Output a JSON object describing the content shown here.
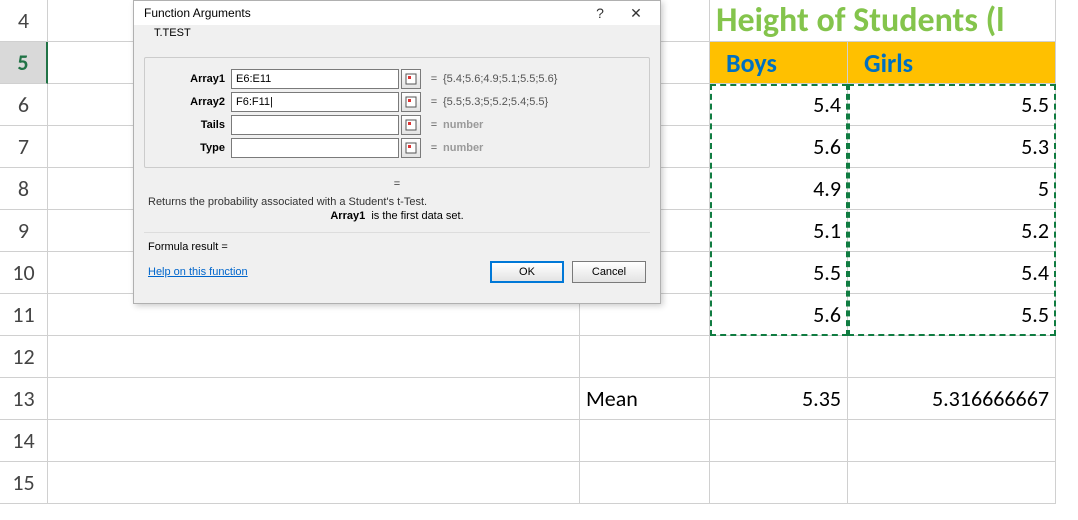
{
  "rows_visible": [
    "4",
    "5",
    "6",
    "7",
    "8",
    "9",
    "10",
    "11",
    "12",
    "13",
    "14",
    "15"
  ],
  "active_row": "5",
  "title_text": "Height of Students (l",
  "headers": {
    "boys": "Boys",
    "girls": "Girls"
  },
  "data": {
    "boys": [
      "5.4",
      "5.6",
      "4.9",
      "5.1",
      "5.5",
      "5.6"
    ],
    "girls": [
      "5.5",
      "5.3",
      "5",
      "5.2",
      "5.4",
      "5.5"
    ]
  },
  "mean_label": "Mean",
  "mean_boys": "5.35",
  "mean_girls": "5.316666667",
  "dialog": {
    "title": "Function Arguments",
    "fn_name": "T.TEST",
    "args": [
      {
        "label": "Array1",
        "value": "E6:E11",
        "result": "{5.4;5.6;4.9;5.1;5.5;5.6}",
        "dim": false
      },
      {
        "label": "Array2",
        "value": "F6:F11|",
        "result": "{5.5;5.3;5;5.2;5.4;5.5}",
        "dim": false
      },
      {
        "label": "Tails",
        "value": "",
        "result": "number",
        "dim": true
      },
      {
        "label": "Type",
        "value": "",
        "result": "number",
        "dim": true
      }
    ],
    "eq_only": "=",
    "desc_main": "Returns the probability associated with a Student's t-Test.",
    "desc_arg_name": "Array1",
    "desc_arg_text": "is the first data set.",
    "formula_result_label": "Formula result =",
    "help_link": "Help on this function",
    "ok": "OK",
    "cancel": "Cancel"
  },
  "chart_data": {
    "type": "table",
    "title": "Height of Students",
    "columns": [
      "Boys",
      "Girls"
    ],
    "rows": [
      [
        5.4,
        5.5
      ],
      [
        5.6,
        5.3
      ],
      [
        4.9,
        5.0
      ],
      [
        5.1,
        5.2
      ],
      [
        5.5,
        5.4
      ],
      [
        5.6,
        5.5
      ]
    ],
    "summary": {
      "Mean": [
        5.35,
        5.316666667
      ]
    }
  }
}
